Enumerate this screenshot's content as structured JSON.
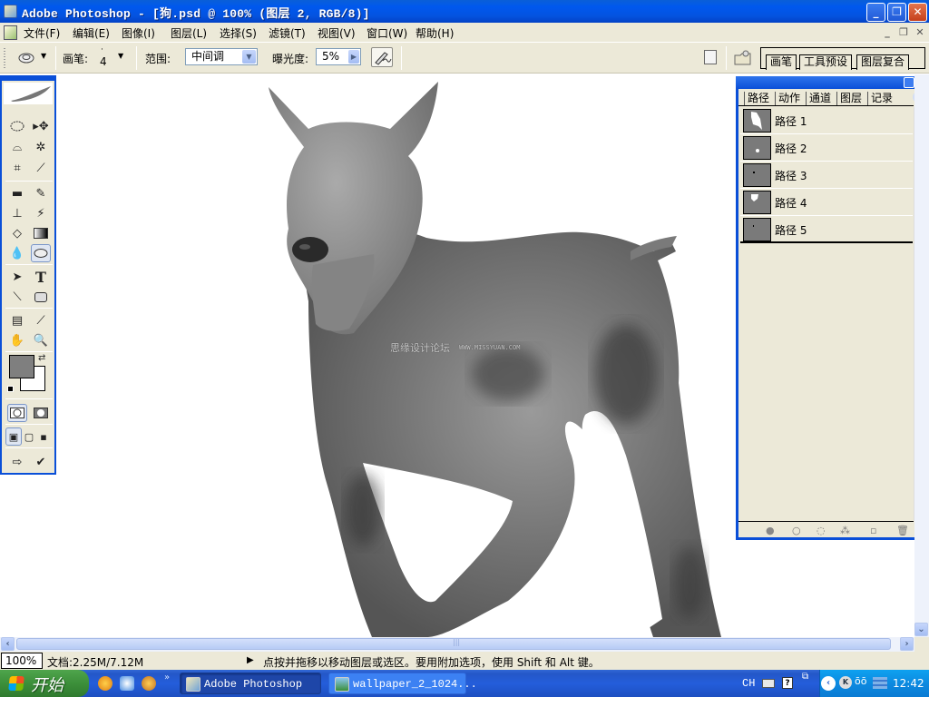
{
  "window": {
    "title": "Adobe Photoshop - [狗.psd @ 100% (图层 2, RGB/8)]",
    "minimize": "_",
    "restore": "❐",
    "close": "✕"
  },
  "menu": {
    "items": [
      "文件(F)",
      "编辑(E)",
      "图像(I)",
      "图层(L)",
      "选择(S)",
      "滤镜(T)",
      "视图(V)",
      "窗口(W)",
      "帮助(H)"
    ],
    "mdi_min": "_",
    "mdi_restore": "❐",
    "mdi_close": "✕"
  },
  "options": {
    "tool_icon": "dodge-tool",
    "brush_label": "画笔:",
    "brush_size": "4",
    "range_label": "范围:",
    "range_value": "中间调",
    "exposure_label": "曝光度:",
    "exposure_value": "5%",
    "airbrush_icon": "airbrush"
  },
  "palette_well": {
    "tabs": [
      "画笔",
      "工具预设",
      "图层复合"
    ]
  },
  "paths_panel": {
    "tabs": [
      "路径",
      "动作",
      "通道",
      "图层",
      "记录"
    ],
    "active_tab": "路径",
    "paths": [
      {
        "name": "路径 1"
      },
      {
        "name": "路径 2"
      },
      {
        "name": "路径 3"
      },
      {
        "name": "路径 4"
      },
      {
        "name": "路径 5"
      }
    ],
    "footer_icons": [
      "fill-path",
      "stroke-path",
      "load-selection",
      "make-work-path",
      "new-path",
      "delete-path"
    ]
  },
  "canvas": {
    "watermark_cn": "思缘设计论坛",
    "watermark_url": "WWW.MISSYUAN.COM"
  },
  "colors": {
    "foreground": "#7f7f7f",
    "background": "#ffffff",
    "xp_blue": "#0a4fd8",
    "panel_bg": "#ece9d8"
  },
  "status": {
    "zoom": "100%",
    "doc_info": "文档:2.25M/7.12M",
    "hint": "点按并拖移以移动图层或选区。要用附加选项，使用 Shift 和 Alt 键。"
  },
  "taskbar": {
    "start_label": "开始",
    "tasks": [
      {
        "label": "Adobe Photoshop ...",
        "active": true
      },
      {
        "label": "wallpaper_2_1024...",
        "active": false
      }
    ],
    "tray": {
      "lang": "CH",
      "clock": "12:42"
    }
  }
}
